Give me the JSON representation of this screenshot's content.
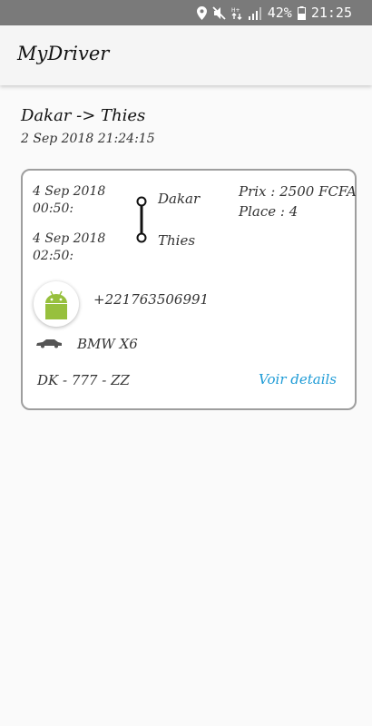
{
  "status_bar": {
    "battery": "42%",
    "time": "21:25"
  },
  "app": {
    "title": "MyDriver"
  },
  "trip": {
    "route": "Dakar -> Thies",
    "created_at": "2 Sep 2018 21:24:15",
    "departure": {
      "date": "4 Sep 2018",
      "time": "00:50:",
      "city": "Dakar"
    },
    "arrival": {
      "date": "4 Sep 2018",
      "time": "02:50:",
      "city": "Thies"
    },
    "price": "Prix : 2500 FCFA",
    "seats": "Place : 4",
    "driver_phone": "+221763506991",
    "car_model": "BMW X6",
    "plate": "DK - 777 - ZZ",
    "details_label": "Voir details"
  },
  "colors": {
    "status_bar": "#7a7a7a",
    "link": "#1d9bd6",
    "android_green": "#97c03d"
  },
  "icons": [
    "location-icon",
    "mute-icon",
    "data-icon",
    "signal-icon",
    "battery-icon",
    "android-avatar-icon",
    "car-icon"
  ]
}
